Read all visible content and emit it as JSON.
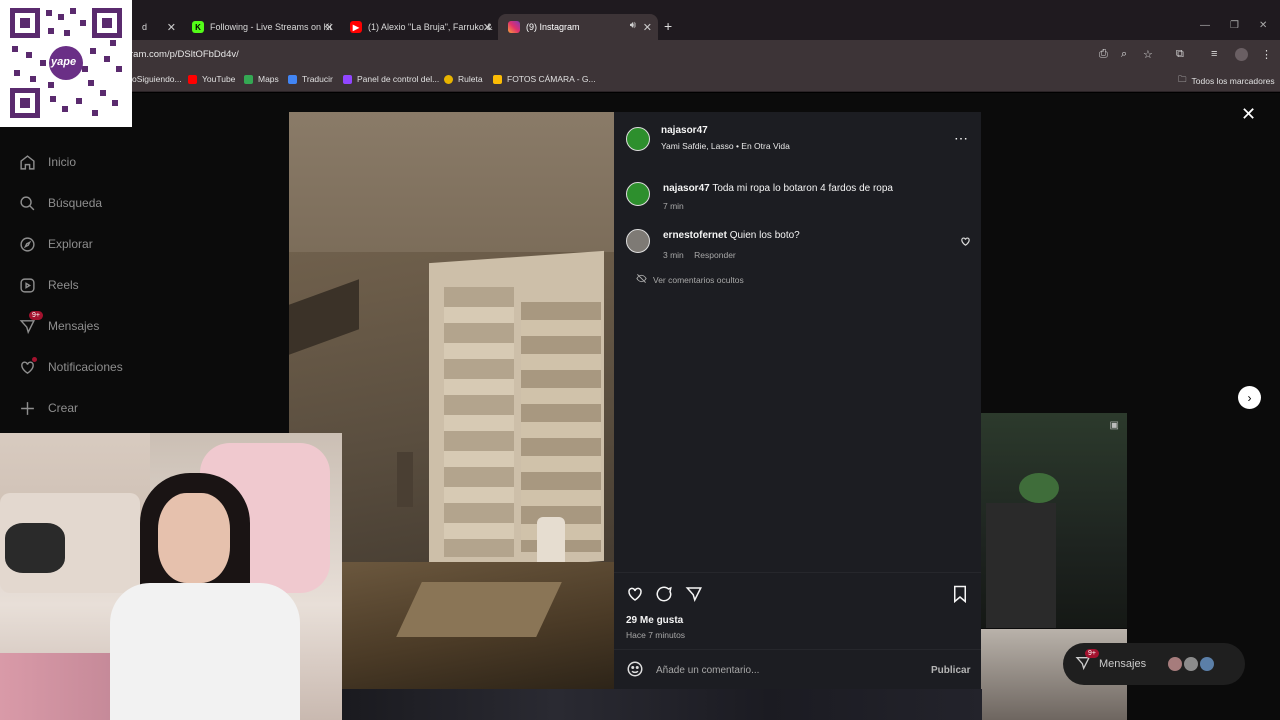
{
  "browser": {
    "tabs": [
      {
        "label": "d",
        "active": false
      },
      {
        "label": "Following - Live Streams on Ki",
        "active": false
      },
      {
        "label": "(1) Alexio \"La Bruja\", Farruko &",
        "active": false
      },
      {
        "label": "(9) Instagram",
        "active": true
      }
    ],
    "url": "ram.com/p/DSltOFbDd4v/",
    "bookmarks": [
      "oSiguiendo...",
      "YouTube",
      "Maps",
      "Traducir",
      "Panel de control del...",
      "Ruleta",
      "FOTOS CÁMARA - G...",
      "Todos los marcadores"
    ]
  },
  "sidebar": {
    "items": [
      {
        "label": "Inicio",
        "icon": "home-icon"
      },
      {
        "label": "Búsqueda",
        "icon": "search-icon"
      },
      {
        "label": "Explorar",
        "icon": "compass-icon"
      },
      {
        "label": "Reels",
        "icon": "reels-icon"
      },
      {
        "label": "Mensajes",
        "icon": "messenger-icon",
        "badge": "9+"
      },
      {
        "label": "Notificaciones",
        "icon": "heart-icon"
      },
      {
        "label": "Crear",
        "icon": "plus-icon"
      }
    ]
  },
  "qr": {
    "brand": "yape"
  },
  "post": {
    "author": "najasor47",
    "audio": "Yami Safdie, Lasso • En Otra Vida",
    "caption_user": "najasor47",
    "caption": "Toda mi ropa lo botaron 4 fardos de ropa",
    "caption_time": "7 min",
    "comments": [
      {
        "user": "ernestofernet",
        "text": "Quien los boto?",
        "time": "3 min",
        "reply": "Responder"
      }
    ],
    "hidden_comments": "Ver comentarios ocultos",
    "likes": "29 Me gusta",
    "time_ago": "Hace 7 minutos",
    "comment_placeholder": "Añade un comentario...",
    "publish": "Publicar"
  },
  "messages_pill": {
    "label": "Mensajes",
    "badge": "9+"
  }
}
